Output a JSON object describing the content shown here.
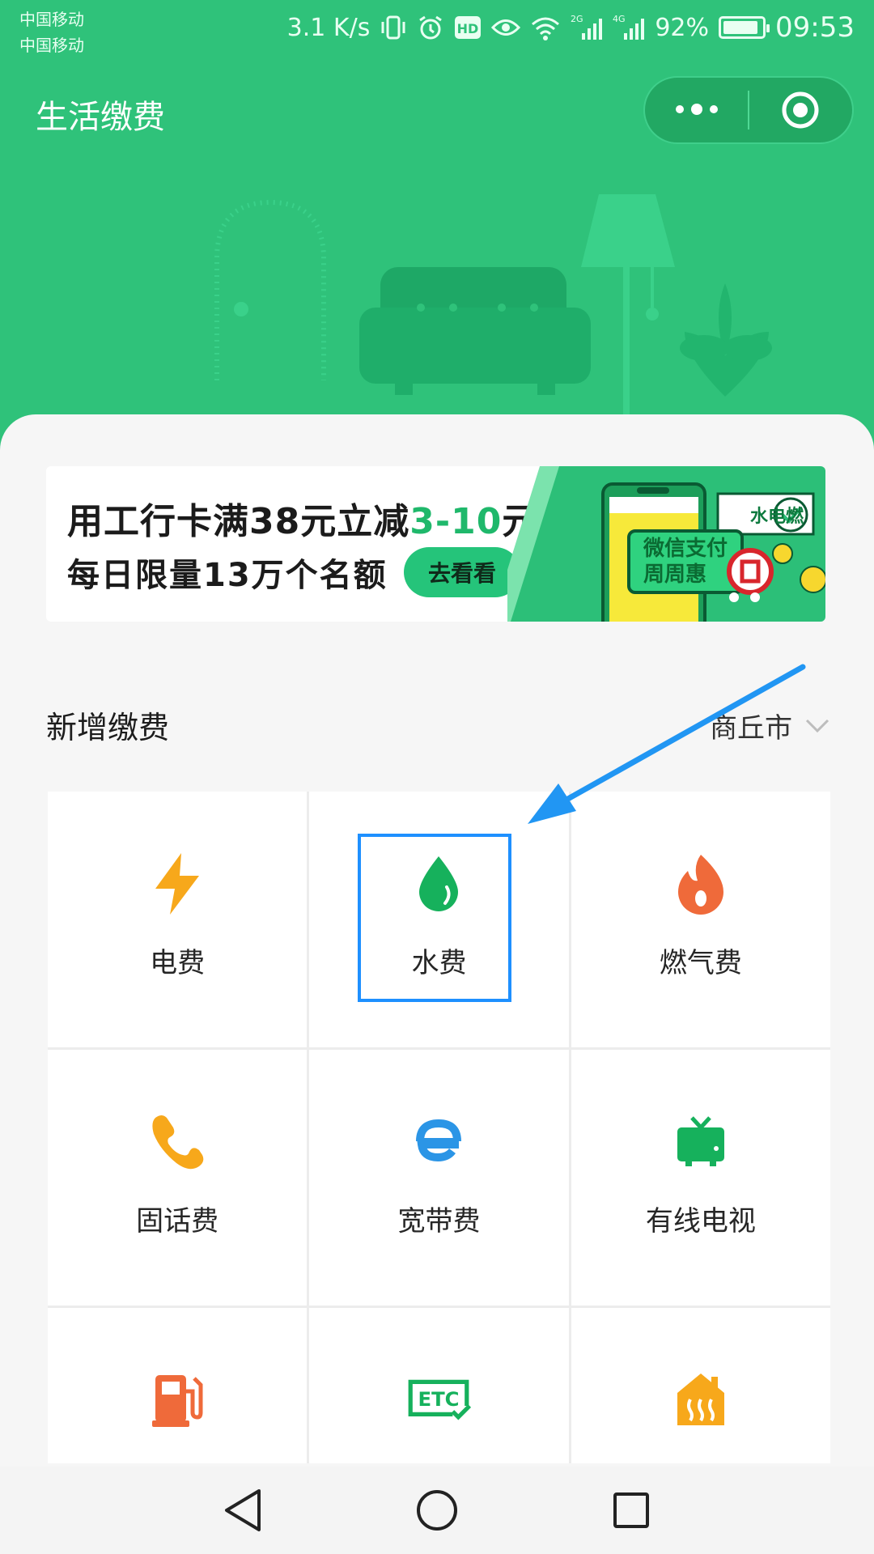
{
  "status_bar": {
    "carrier_1": "中国移动",
    "carrier_2": "中国移动",
    "network_speed": "3.1 K/s",
    "hd_badge": "HD",
    "sim1_network": "2G",
    "sim2_network": "4G",
    "battery": "92%",
    "battery_level": 0.92,
    "time": "09:53"
  },
  "header": {
    "title": "生活缴费",
    "more_icon": "more-dots-icon",
    "close_icon": "target-circle-icon",
    "background_color": "#2fc27a"
  },
  "banner": {
    "line1_prefix": "用工行卡满",
    "line1_amount": "38",
    "line1_mid": "元立减",
    "line1_discount": "3-10",
    "line1_suffix": "元",
    "line2": "每日限量13万个名额",
    "button": "去看看",
    "tag_utilities": "水电燃",
    "promo_line1": "微信支付",
    "promo_line2": "周周惠"
  },
  "section": {
    "title": "新增缴费",
    "city": "商丘市"
  },
  "services": [
    {
      "label": "电费",
      "icon": "lightning-icon",
      "color": "#f7a81b"
    },
    {
      "label": "水费",
      "icon": "water-drop-icon",
      "color": "#16b15c",
      "selected": true
    },
    {
      "label": "燃气费",
      "icon": "flame-icon",
      "color": "#ef6a3a"
    },
    {
      "label": "固话费",
      "icon": "phone-icon",
      "color": "#f7a81b"
    },
    {
      "label": "宽带费",
      "icon": "broadband-e-icon",
      "color": "#2b95e6"
    },
    {
      "label": "有线电视",
      "icon": "tv-icon",
      "color": "#16b15c"
    },
    {
      "label": "",
      "icon": "fuel-pump-icon",
      "color": "#ef6a3a"
    },
    {
      "label": "",
      "icon": "etc-icon",
      "color": "#16b15c"
    },
    {
      "label": "",
      "icon": "heating-icon",
      "color": "#f7a81b"
    }
  ],
  "annotation": {
    "arrow_color": "#2196f3"
  },
  "navbar": {
    "back_icon": "back-triangle-icon",
    "home_icon": "home-circle-icon",
    "recents_icon": "recents-square-icon"
  }
}
